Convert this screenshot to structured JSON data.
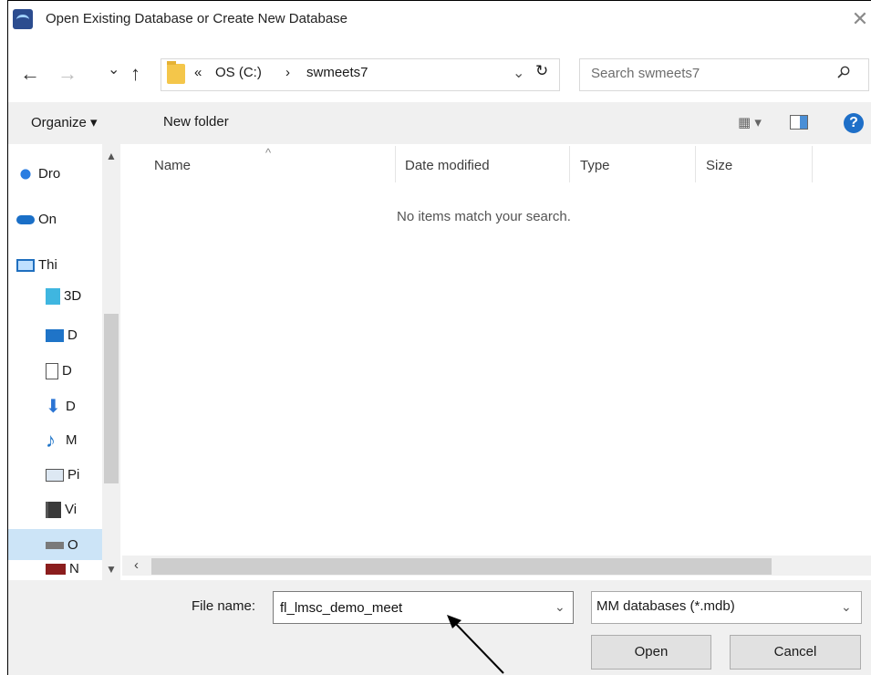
{
  "window": {
    "title": "Open Existing Database or Create New Database",
    "close": "✕"
  },
  "nav": {
    "back": "←",
    "forward": "→",
    "recent": "⌄",
    "up": "↑"
  },
  "address": {
    "prefix": "«",
    "crumbs": [
      "OS (C:)",
      "swmeets7"
    ],
    "separator": "›",
    "dropdown": "⌄",
    "refresh": "↻"
  },
  "search": {
    "placeholder": "Search swmeets7"
  },
  "toolbar": {
    "organize": "Organize ▾",
    "new_folder": "New folder",
    "view": "▦ ▾",
    "help": "?"
  },
  "sidebar": {
    "items": [
      {
        "label": "Dro",
        "icon": "dropbox-icon"
      },
      {
        "label": "On",
        "icon": "onedrive-icon"
      },
      {
        "label": "Thi",
        "icon": "this-pc-icon"
      },
      {
        "label": "3D",
        "icon": "3d-objects-icon"
      },
      {
        "label": "D",
        "icon": "desktop-icon"
      },
      {
        "label": "D",
        "icon": "documents-icon"
      },
      {
        "label": "D",
        "icon": "downloads-icon"
      },
      {
        "label": "M",
        "icon": "music-icon"
      },
      {
        "label": "Pi",
        "icon": "pictures-icon"
      },
      {
        "label": "Vi",
        "icon": "videos-icon"
      },
      {
        "label": "O",
        "icon": "drive-icon"
      },
      {
        "label": "N",
        "icon": "sd-card-icon"
      }
    ]
  },
  "columns": {
    "name": "Name",
    "date": "Date modified",
    "type": "Type",
    "size": "Size",
    "sort": "^"
  },
  "list": {
    "empty_message": "No items match your search."
  },
  "bottom": {
    "filename_label": "File name:",
    "filename_value": "fl_lmsc_demo_meet",
    "filter_value": "MM databases (*.mdb)",
    "open": "Open",
    "cancel": "Cancel"
  },
  "colors": {
    "accent": "#1e6fc8",
    "selection": "#cce4f7",
    "toolbar_bg": "#f0f0f0"
  }
}
